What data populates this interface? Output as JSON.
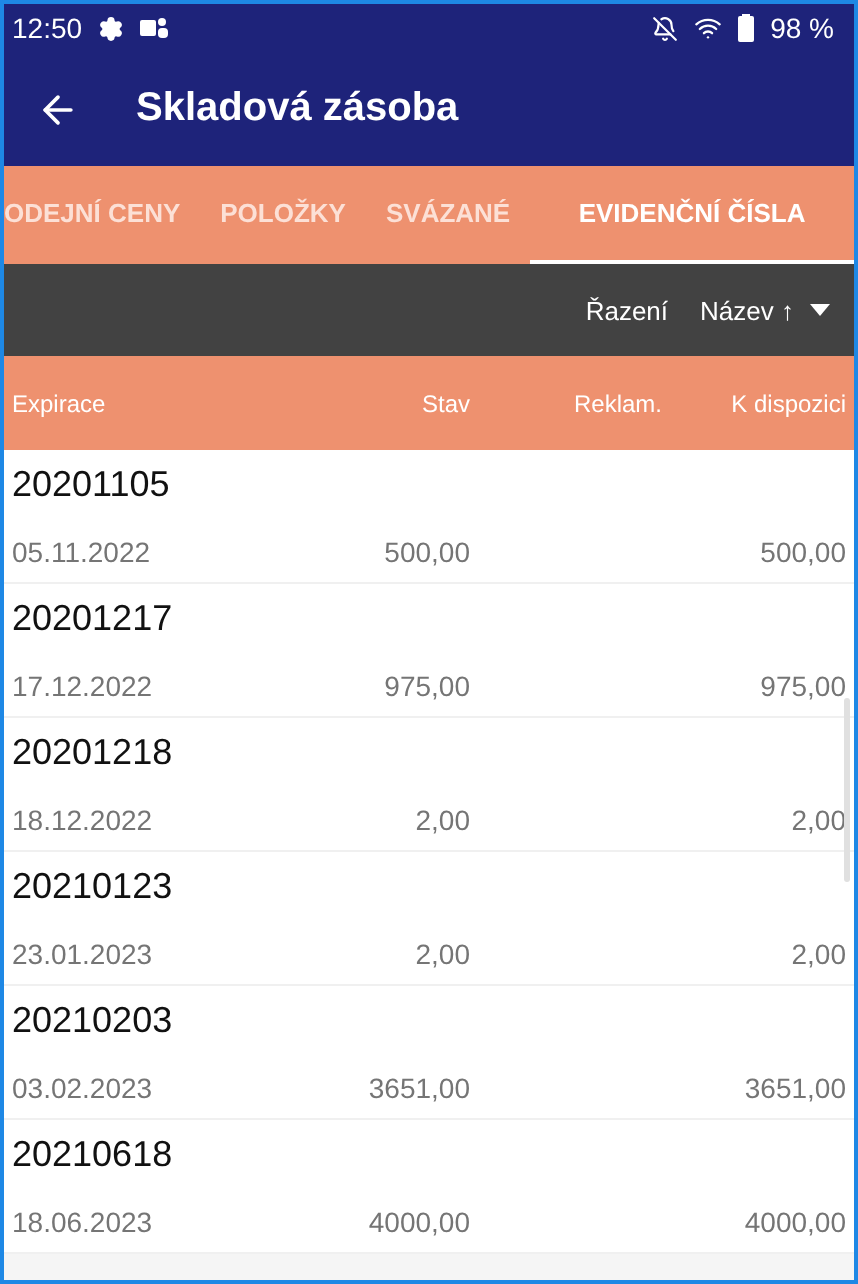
{
  "status_bar": {
    "time": "12:50",
    "battery": "98 %"
  },
  "app_bar": {
    "title": "Skladová zásoba"
  },
  "tabs": [
    {
      "label": "ODEJNÍ CENY",
      "selected": false
    },
    {
      "label": "POLOŽKY",
      "selected": false
    },
    {
      "label": "SVÁZANÉ",
      "selected": false
    },
    {
      "label": "EVIDENČNÍ ČÍSLA",
      "selected": true
    }
  ],
  "sort_bar": {
    "label": "Řazení",
    "value": "Název ↑"
  },
  "table": {
    "columns": [
      "Expirace",
      "Stav",
      "Reklam.",
      "K dispozici"
    ],
    "rows": [
      {
        "number": "20201105",
        "expiry": "05.11.2022",
        "stock": "500,00",
        "available": "500,00"
      },
      {
        "number": "20201217",
        "expiry": "17.12.2022",
        "stock": "975,00",
        "available": "975,00"
      },
      {
        "number": "20201218",
        "expiry": "18.12.2022",
        "stock": "2,00",
        "available": "2,00"
      },
      {
        "number": "20210123",
        "expiry": "23.01.2023",
        "stock": "2,00",
        "available": "2,00"
      },
      {
        "number": "20210203",
        "expiry": "03.02.2023",
        "stock": "3651,00",
        "available": "3651,00"
      },
      {
        "number": "20210618",
        "expiry": "18.06.2023",
        "stock": "4000,00",
        "available": "4000,00"
      }
    ]
  }
}
